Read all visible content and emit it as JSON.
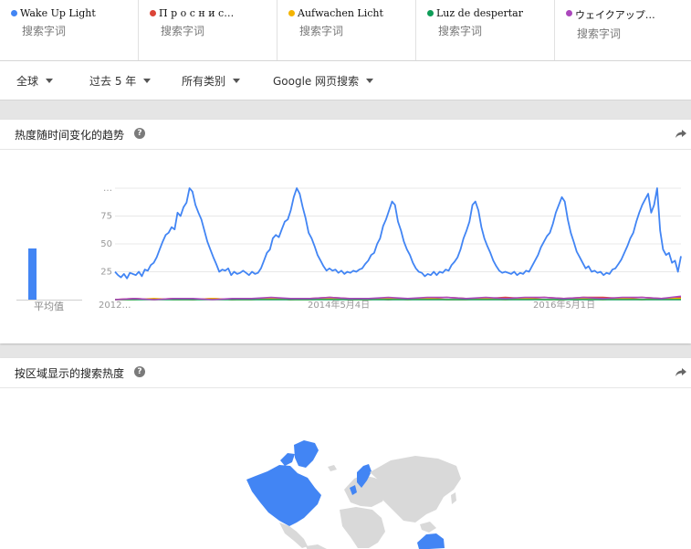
{
  "terms": [
    {
      "name": "Wake Up Light",
      "sub": "搜索字词",
      "color": "#4285f4"
    },
    {
      "name": "П р о с н и с…",
      "sub": "搜索字词",
      "color": "#db4437"
    },
    {
      "name": "Aufwachen Licht",
      "sub": "搜索字词",
      "color": "#f4b400"
    },
    {
      "name": "Luz de despertar",
      "sub": "搜索字词",
      "color": "#0f9d58"
    },
    {
      "name": "ウェイクアップ…",
      "sub": "搜索字词",
      "color": "#ab47bc"
    }
  ],
  "filters": {
    "region": "全球",
    "time": "过去 5 年",
    "category": "所有类别",
    "property": "Google 网页搜索"
  },
  "interest_card": {
    "title": "热度随时间变化的趋势",
    "help": "?",
    "average_label": "平均值"
  },
  "region_card": {
    "title": "按区域显示的搜索热度",
    "help": "?"
  },
  "chart_data": {
    "type": "line",
    "y_ticks": [
      "…",
      "75",
      "50",
      "25"
    ],
    "x_ticks": [
      "2012…",
      "2014年5月4日",
      "2016年5月1日"
    ],
    "ylim": [
      0,
      100
    ],
    "grid": true,
    "averages": [
      {
        "series": "Wake Up Light",
        "value": 44
      },
      {
        "series": "П р о с н и с…",
        "value": 0
      },
      {
        "series": "Aufwachen Licht",
        "value": 0
      },
      {
        "series": "Luz de despertar",
        "value": 0
      },
      {
        "series": "ウェイクアップ…",
        "value": 0
      }
    ],
    "series": [
      {
        "name": "Wake Up Light",
        "color": "#4285f4",
        "values": [
          25,
          22,
          20,
          23,
          19,
          24,
          23,
          22,
          25,
          21,
          27,
          26,
          31,
          33,
          38,
          45,
          52,
          58,
          60,
          65,
          63,
          78,
          75,
          83,
          87,
          100,
          97,
          85,
          78,
          72,
          62,
          52,
          45,
          38,
          32,
          25,
          27,
          26,
          28,
          22,
          25,
          23,
          24,
          26,
          24,
          22,
          25,
          23,
          24,
          28,
          35,
          42,
          45,
          55,
          58,
          56,
          63,
          70,
          72,
          80,
          92,
          100,
          95,
          83,
          73,
          60,
          55,
          48,
          40,
          35,
          30,
          26,
          28,
          26,
          27,
          24,
          26,
          23,
          25,
          24,
          26,
          25,
          27,
          28,
          32,
          35,
          40,
          42,
          50,
          55,
          66,
          72,
          80,
          88,
          85,
          70,
          62,
          52,
          45,
          40,
          33,
          28,
          25,
          24,
          21,
          23,
          22,
          25,
          22,
          25,
          24,
          27,
          26,
          31,
          34,
          38,
          45,
          55,
          62,
          70,
          85,
          88,
          80,
          65,
          55,
          48,
          42,
          35,
          30,
          26,
          24,
          25,
          24,
          23,
          25,
          22,
          24,
          23,
          26,
          25,
          30,
          35,
          40,
          47,
          52,
          57,
          60,
          68,
          78,
          85,
          92,
          88,
          72,
          60,
          52,
          43,
          38,
          33,
          28,
          30,
          25,
          26,
          24,
          25,
          22,
          24,
          23,
          27,
          28,
          32,
          36,
          42,
          48,
          55,
          60,
          70,
          78,
          85,
          90,
          95,
          78,
          85,
          100,
          62,
          45,
          40,
          42,
          33,
          35,
          25,
          39
        ]
      },
      {
        "name": "П р о с н и с…",
        "color": "#db4437",
        "values": [
          0,
          1,
          0,
          1,
          0,
          1,
          0,
          1,
          1,
          0,
          1,
          2,
          1,
          1,
          0,
          1,
          1,
          2,
          1,
          1,
          2,
          1,
          2,
          1,
          2,
          2,
          1,
          2,
          1,
          2
        ]
      },
      {
        "name": "Aufwachen Licht",
        "color": "#f4b400",
        "values": [
          0,
          0,
          1,
          0,
          0,
          1,
          0,
          0,
          1,
          0,
          0,
          1,
          0,
          0,
          1,
          0,
          1,
          0,
          0,
          1,
          0,
          1,
          0,
          0,
          1,
          0,
          1,
          0,
          1,
          1
        ]
      },
      {
        "name": "Luz de despertar",
        "color": "#0f9d58",
        "values": [
          0,
          0,
          0,
          0,
          0,
          0,
          0,
          0,
          0,
          0,
          0,
          0,
          0,
          0,
          0,
          0,
          0,
          0,
          0,
          0,
          0,
          0,
          0,
          0,
          0,
          0,
          0,
          0,
          0,
          0
        ]
      },
      {
        "name": "ウェイクアップ…",
        "color": "#ab47bc",
        "values": [
          0,
          1,
          0,
          1,
          1,
          0,
          1,
          1,
          2,
          1,
          1,
          2,
          1,
          1,
          2,
          1,
          2,
          2,
          1,
          2,
          1,
          2,
          2,
          1,
          2,
          1,
          2,
          2,
          1,
          3
        ]
      }
    ]
  },
  "map_colors": {
    "land": "#d9d9d9",
    "highlight": "#4285f4"
  },
  "icons": {
    "share": "share-icon",
    "help": "help-icon",
    "dropdown": "caret-down-icon"
  }
}
